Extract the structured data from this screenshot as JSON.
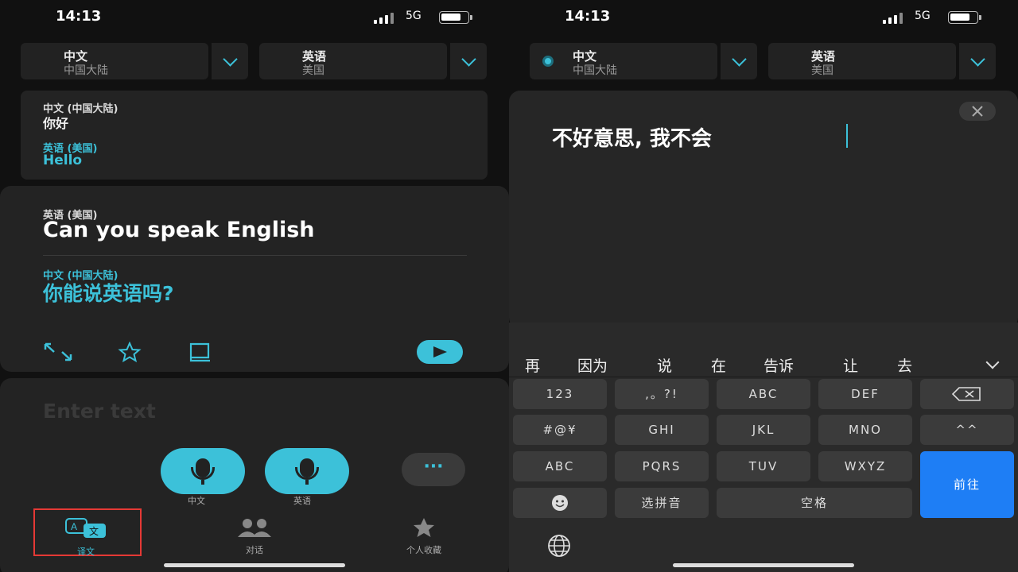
{
  "status": {
    "time": "14:13",
    "network": "5G"
  },
  "left": {
    "source_lang": {
      "name": "中文",
      "region": "中国大陆"
    },
    "target_lang": {
      "name": "英语",
      "region": "美国"
    },
    "history": {
      "src_label": "中文 (中国大陆)",
      "src_text": "你好",
      "dst_label": "英语 (美国)",
      "dst_text": "Hello"
    },
    "current": {
      "src_label": "英语 (美国)",
      "src_text": "Can you speak English",
      "dst_label": "中文 (中国大陆)",
      "dst_text": "你能说英语吗?"
    },
    "input_placeholder": "Enter text",
    "mic_buttons": [
      "中文",
      "英语"
    ],
    "tabs": [
      "译文",
      "对话",
      "个人收藏"
    ]
  },
  "right": {
    "source_lang": {
      "name": "中文",
      "region": "中国大陆"
    },
    "target_lang": {
      "name": "英语",
      "region": "美国"
    },
    "input_text": "不好意思, 我不会",
    "candidates": [
      "再",
      "因为",
      "说",
      "在",
      "告诉",
      "让",
      "去"
    ],
    "keys": {
      "row1": [
        "123",
        ",。?!",
        "ABC",
        "DEF"
      ],
      "row2": [
        "#@¥",
        "GHI",
        "JKL",
        "MNO",
        "^^"
      ],
      "row3": [
        "ABC",
        "PQRS",
        "TUV",
        "WXYZ"
      ],
      "go": "前往",
      "pinyin": "选拼音",
      "space": "空格"
    }
  },
  "colors": {
    "accent": "#3cc1d9",
    "go_key": "#1e7ef5",
    "highlight": "#e53935"
  }
}
